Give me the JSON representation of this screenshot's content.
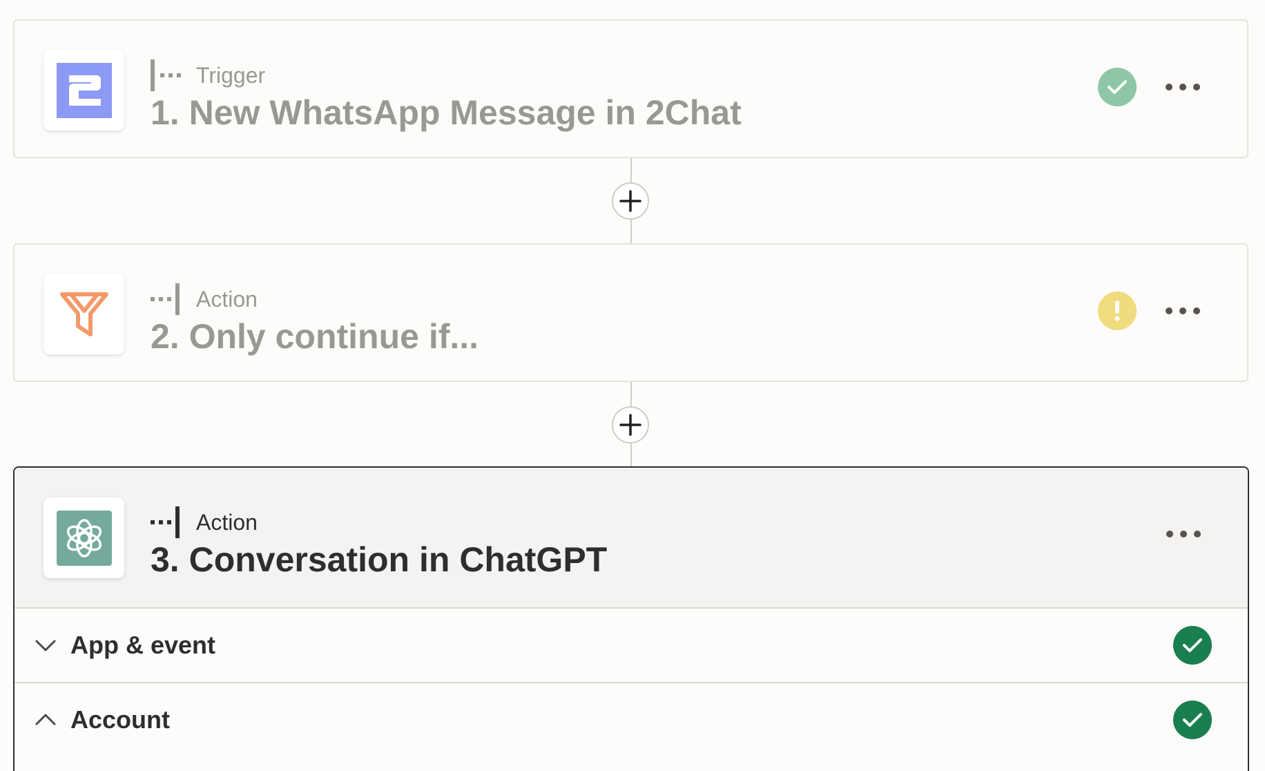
{
  "colors": {
    "page_bg": "#fdfcfa",
    "success_light": "#8ec6a6",
    "warning": "#f0dc7e",
    "success_dark": "#1a7f4e",
    "twochat_brand": "#8c99f5",
    "filter_brand": "#f39a6a",
    "chatgpt_brand": "#74aa9c"
  },
  "steps": [
    {
      "type_label": "Trigger",
      "title": "1. New WhatsApp Message in 2Chat",
      "app_icon": "2chat-logo-icon",
      "status": "success",
      "status_icon": "check-icon"
    },
    {
      "type_label": "Action",
      "title": "2. Only continue if...",
      "app_icon": "filter-icon",
      "status": "warning",
      "status_icon": "exclamation-icon"
    },
    {
      "type_label": "Action",
      "title": "3. Conversation in ChatGPT",
      "app_icon": "chatgpt-logo-icon",
      "status": "active"
    }
  ],
  "active_sections": [
    {
      "label": "App & event",
      "expanded": false,
      "chevron_icon": "chevron-down-icon",
      "status_icon": "check-icon"
    },
    {
      "label": "Account",
      "expanded": true,
      "chevron_icon": "chevron-up-icon",
      "status_icon": "check-icon"
    }
  ]
}
